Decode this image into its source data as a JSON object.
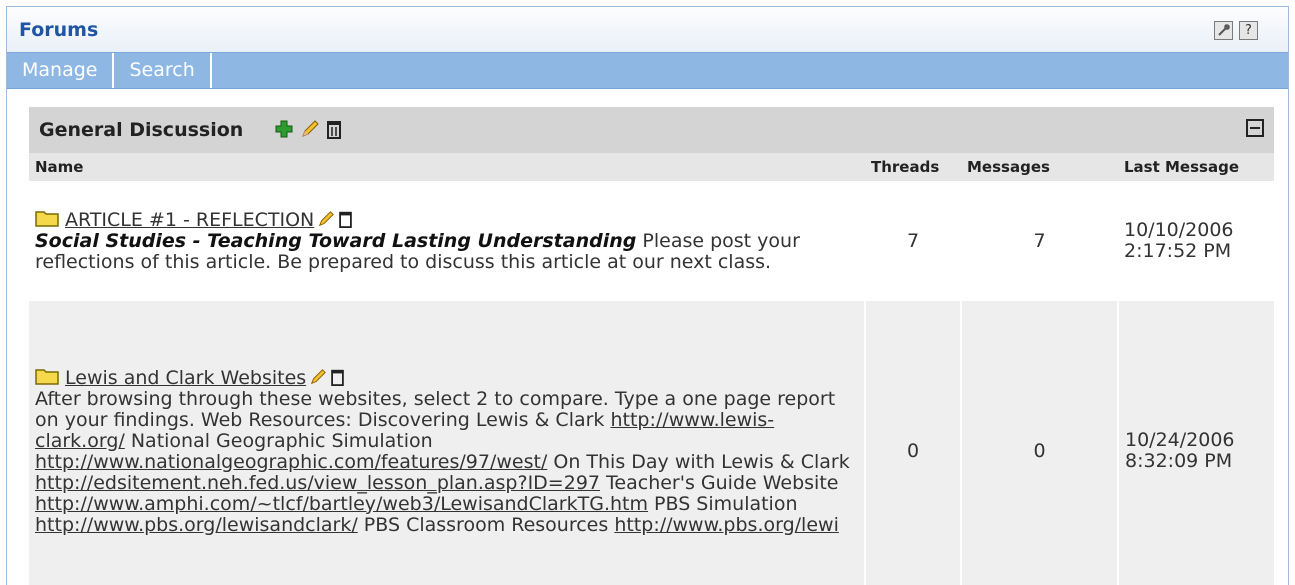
{
  "portlet": {
    "title": "Forums",
    "settings_icon": "tool-icon",
    "help_label": "?"
  },
  "tabs": [
    {
      "label": "Manage"
    },
    {
      "label": "Search"
    }
  ],
  "section": {
    "title": "General Discussion"
  },
  "columns": {
    "name": "Name",
    "threads": "Threads",
    "messages": "Messages",
    "last": "Last Message"
  },
  "forums": [
    {
      "name": "ARTICLE #1 - REFLECTION",
      "desc_bold": "Social Studies - Teaching Toward Lasting Understanding",
      "desc": "Please post your reflections of this article. Be prepared to discuss this article at our next class.",
      "threads": "7",
      "messages": "7",
      "last_date": "10/10/2006",
      "last_time": "2:17:52 PM"
    },
    {
      "name": "Lewis and Clark Websites",
      "desc_parts": [
        {
          "t": "After browsing through these websites, select 2 to compare. Type a one page report on your findings. Web Resources: Discovering Lewis & Clark "
        },
        {
          "link": "http://www.lewis-clark.org/"
        },
        {
          "t": " National Geographic Simulation "
        },
        {
          "link": "http://www.nationalgeographic.com/features/97/west/"
        },
        {
          "t": " On This Day with Lewis & Clark "
        },
        {
          "link": "http://edsitement.neh.fed.us/view_lesson_plan.asp?ID=297"
        },
        {
          "t": " Teacher's Guide Website "
        },
        {
          "link": "http://www.amphi.com/~tlcf/bartley/web3/LewisandClarkTG.htm"
        },
        {
          "t": " PBS Simulation "
        },
        {
          "link": "http://www.pbs.org/lewisandclark/"
        },
        {
          "t": " PBS Classroom Resources "
        },
        {
          "link": "http://www.pbs.org/lewi"
        }
      ],
      "threads": "0",
      "messages": "0",
      "last_date": "10/24/2006",
      "last_time": "8:32:09 PM"
    }
  ]
}
